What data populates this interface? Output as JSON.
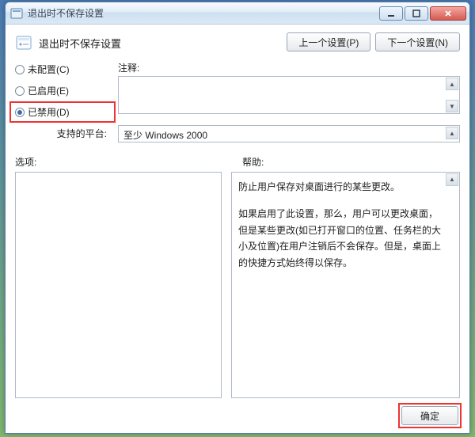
{
  "window": {
    "title": "退出时不保存设置",
    "min_tip": "minimize",
    "max_tip": "maximize",
    "close_tip": "close"
  },
  "header": {
    "title": "退出时不保存设置",
    "prev_button": "上一个设置(P)",
    "next_button": "下一个设置(N)"
  },
  "config": {
    "radios": {
      "not_configured": "未配置(C)",
      "enabled": "已启用(E)",
      "disabled": "已禁用(D)",
      "selected": "disabled"
    },
    "comment_label": "注释:",
    "comment_value": ""
  },
  "platform": {
    "label": "支持的平台:",
    "value": "至少 Windows 2000"
  },
  "panes": {
    "options_label": "选项:",
    "help_label": "帮助:",
    "help_p1": "防止用户保存对桌面进行的某些更改。",
    "help_p2": "如果启用了此设置，那么，用户可以更改桌面，但是某些更改(如已打开窗口的位置、任务栏的大小及位置)在用户注销后不会保存。但是，桌面上的快捷方式始终得以保存。"
  },
  "footer": {
    "ok": "确定"
  }
}
